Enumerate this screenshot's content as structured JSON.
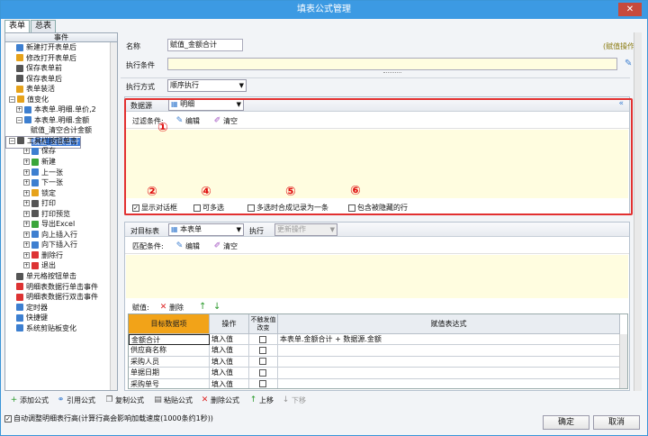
{
  "window": {
    "title": "填表公式管理",
    "close": "✕"
  },
  "tabs": [
    {
      "label": "表单"
    },
    {
      "label": "总表"
    }
  ],
  "tree": {
    "header": "事件",
    "nodes": [
      {
        "label": "新建打开表单后",
        "indent": 1,
        "color": "#3d7fd0"
      },
      {
        "label": "修改打开表单后",
        "indent": 1,
        "color": "#e6a21a"
      },
      {
        "label": "保存表单前",
        "indent": 1,
        "color": "#555"
      },
      {
        "label": "保存表单后",
        "indent": 1,
        "color": "#555"
      },
      {
        "label": "表单装活",
        "indent": 1,
        "color": "#e6a21a"
      },
      {
        "label": "值变化",
        "indent": 0,
        "color": "#e6a21a",
        "exp": "−"
      },
      {
        "label": "本表单.明细.单价,2",
        "indent": 1,
        "color": "#3d7fd0",
        "exp": "+"
      },
      {
        "label": "本表单.明细.金额",
        "indent": 1,
        "color": "#3d7fd0",
        "exp": "−"
      },
      {
        "label": "赋值_清空合计金额",
        "indent": 3,
        "color": ""
      },
      {
        "label": "赋值_金额合计",
        "indent": 3,
        "color": "",
        "selected": true
      },
      {
        "label": "工具栏按钮单击",
        "indent": 0,
        "color": "#555",
        "exp": "−"
      },
      {
        "label": "保存",
        "indent": 2,
        "color": "#3d7fd0",
        "exp": "+"
      },
      {
        "label": "新建",
        "indent": 2,
        "color": "#3aa63a",
        "exp": "+"
      },
      {
        "label": "上一张",
        "indent": 2,
        "color": "#3d7fd0",
        "exp": "+"
      },
      {
        "label": "下一张",
        "indent": 2,
        "color": "#3d7fd0",
        "exp": "+"
      },
      {
        "label": "锁定",
        "indent": 2,
        "color": "#e6a21a",
        "exp": "+"
      },
      {
        "label": "打印",
        "indent": 2,
        "color": "#555",
        "exp": "+"
      },
      {
        "label": "打印预览",
        "indent": 2,
        "color": "#555",
        "exp": "+"
      },
      {
        "label": "导出Excel",
        "indent": 2,
        "color": "#3aa63a",
        "exp": "+"
      },
      {
        "label": "向上插入行",
        "indent": 2,
        "color": "#3d7fd0",
        "exp": "+"
      },
      {
        "label": "向下插入行",
        "indent": 2,
        "color": "#3d7fd0",
        "exp": "+"
      },
      {
        "label": "删除行",
        "indent": 2,
        "color": "#d33",
        "exp": "+"
      },
      {
        "label": "退出",
        "indent": 2,
        "color": "#d33",
        "exp": "+"
      },
      {
        "label": "单元格按钮单击",
        "indent": 1,
        "color": "#555"
      },
      {
        "label": "明细表数据行单击事件",
        "indent": 1,
        "color": "#d33"
      },
      {
        "label": "明细表数据行双击事件",
        "indent": 1,
        "color": "#d33"
      },
      {
        "label": "定时器",
        "indent": 1,
        "color": "#3d7fd0"
      },
      {
        "label": "快捷键",
        "indent": 1,
        "color": "#3d7fd0"
      },
      {
        "label": "系统剪贴板变化",
        "indent": 1,
        "color": "#3d7fd0"
      }
    ]
  },
  "form": {
    "name_label": "名称",
    "name_value": "赋值_金额合计",
    "exec_cond_label": "执行条件",
    "assign_link": "(赋值操作)",
    "exec_mode_label": "执行方式",
    "exec_mode_value": "顺序执行"
  },
  "source": {
    "label": "数据源",
    "value": "明细",
    "filter_label": "过滤条件:",
    "edit": "编辑",
    "clear": "清空",
    "options": [
      {
        "label": "显示对话框",
        "checked": true
      },
      {
        "label": "可多选",
        "checked": false
      },
      {
        "label": "多选时合成记录为一条",
        "checked": false
      },
      {
        "label": "包含被隐藏的行",
        "checked": false
      }
    ]
  },
  "annotations": [
    "①",
    "②",
    "④",
    "⑤",
    "⑥"
  ],
  "target": {
    "label": "对目标表",
    "value": "本表单",
    "exec_label": "执行",
    "exec_value": "更新操作",
    "match_label": "匹配条件:",
    "edit": "编辑",
    "clear": "清空",
    "assign_label": "赋值:",
    "delete": "删除"
  },
  "grid": {
    "headers": [
      "目标数据项",
      "操作",
      "不触发值改变",
      "赋值表达式"
    ],
    "rows": [
      {
        "item": "金额合计",
        "op": "填入值",
        "expr": "本表单.金额合计 + 数据源.金额"
      },
      {
        "item": "供应商名称",
        "op": "填入值",
        "expr": ""
      },
      {
        "item": "采购人员",
        "op": "填入值",
        "expr": ""
      },
      {
        "item": "单据日期",
        "op": "填入值",
        "expr": ""
      },
      {
        "item": "采购单号",
        "op": "填入值",
        "expr": ""
      }
    ]
  },
  "toolbar": {
    "add": "添加公式",
    "ref": "引用公式",
    "copy": "复制公式",
    "paste": "粘贴公式",
    "delete": "删除公式",
    "up": "上移",
    "down": "下移"
  },
  "status_text": "自动调整明细表行高(计算行高会影响加载速度(1000条约1秒))",
  "buttons": {
    "ok": "确定",
    "cancel": "取消"
  }
}
